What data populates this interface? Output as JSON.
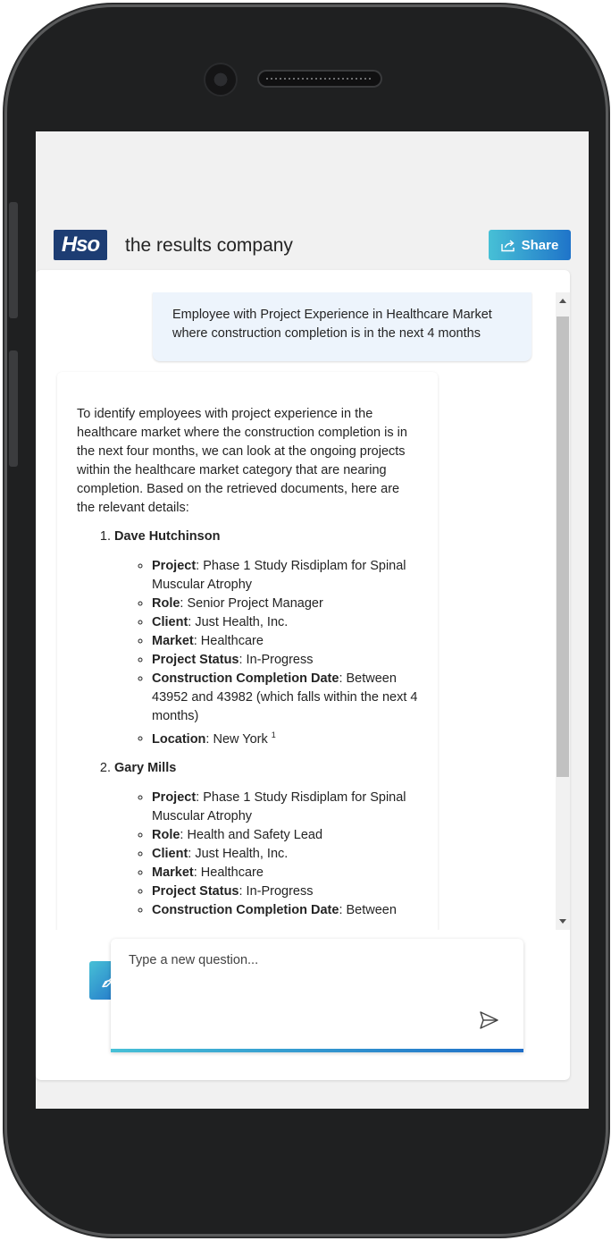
{
  "brand": {
    "logo_text": "Hso",
    "tagline": "the results company"
  },
  "header": {
    "share_label": "Share"
  },
  "conversation": {
    "user_message": "Employee with Project Experience in Healthcare Market where construction completion is in the next 4 months",
    "assistant_intro": "To identify employees with project experience in the healthcare market where the construction completion is in the next four months, we can look at the ongoing projects within the healthcare market category that are nearing completion. Based on the retrieved documents, here are the relevant details:",
    "employees": [
      {
        "name": "Dave Hutchinson",
        "details": [
          {
            "label": "Project",
            "value": ": Phase 1 Study Risdiplam for Spinal Muscular Atrophy"
          },
          {
            "label": "Role",
            "value": ": Senior Project Manager"
          },
          {
            "label": "Client",
            "value": ": Just Health, Inc."
          },
          {
            "label": "Market",
            "value": ": Healthcare"
          },
          {
            "label": "Project Status",
            "value": ": In-Progress"
          },
          {
            "label": "Construction Completion Date",
            "value": ": Between 43952 and 43982 (which falls within the next 4 months)"
          },
          {
            "label": "Location",
            "value": ": New York ",
            "citation": "1"
          }
        ]
      },
      {
        "name": "Gary Mills",
        "details": [
          {
            "label": "Project",
            "value": ": Phase 1 Study Risdiplam for Spinal Muscular Atrophy"
          },
          {
            "label": "Role",
            "value": ": Health and Safety Lead"
          },
          {
            "label": "Client",
            "value": ": Just Health, Inc."
          },
          {
            "label": "Market",
            "value": ": Healthcare"
          },
          {
            "label": "Project Status",
            "value": ": In-Progress"
          },
          {
            "label": "Construction Completion Date",
            "value": ": Between"
          }
        ]
      }
    ]
  },
  "composer": {
    "placeholder": "Type a new question..."
  },
  "icons": {
    "share": "share-icon",
    "clear_chat": "broom-icon",
    "send": "send-icon"
  },
  "colors": {
    "brand_navy": "#1d3d73",
    "accent_start": "#47c0d6",
    "accent_end": "#1f6ec8",
    "user_bubble": "#edf4fc"
  }
}
